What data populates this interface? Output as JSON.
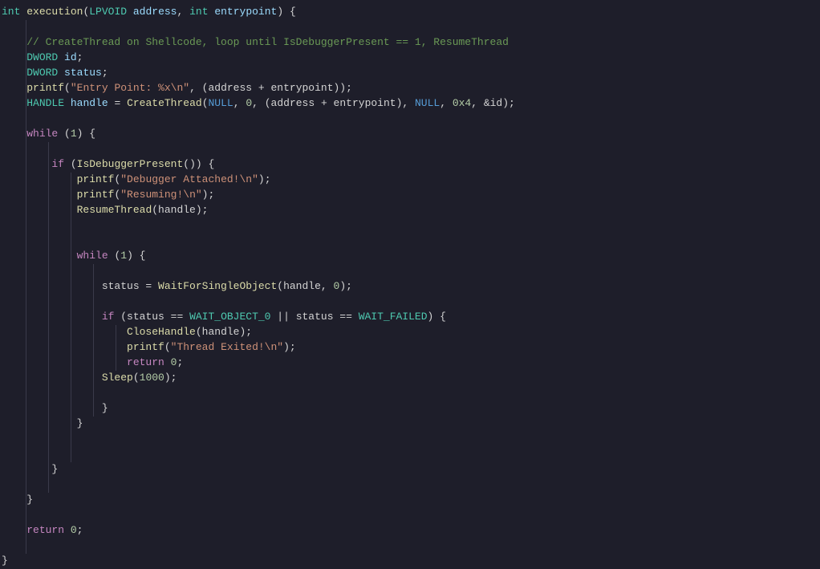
{
  "code": {
    "l0": {
      "ret_type": "int",
      "func": "execution",
      "p1_type": "LPVOID",
      "p1_name": "address",
      "comma": ",",
      "p2_type": "int",
      "p2_name": "entrypoint",
      "open": ") {"
    },
    "l2": {
      "comment": "// CreateThread on Shellcode, loop until IsDebuggerPresent == 1, ResumeThread"
    },
    "l3": {
      "type": "DWORD",
      "name": "id",
      "semi": ";"
    },
    "l4": {
      "type": "DWORD",
      "name": "status",
      "semi": ";"
    },
    "l5": {
      "func": "printf",
      "open": "(",
      "str": "\"Entry Point: %x\\n\"",
      "args": ", (address + entrypoint));"
    },
    "l6": {
      "type": "HANDLE",
      "name": "handle",
      "eq": " = ",
      "func": "CreateThread",
      "open": "(",
      "null1": "NULL",
      "c1": ", ",
      "n0": "0",
      "c2": ", (address + entrypoint), ",
      "null2": "NULL",
      "c3": ", ",
      "hex": "0x4",
      "c4": ", &id);"
    },
    "l8": {
      "kw": "while",
      "rest": " (",
      "num": "1",
      "close": ") {"
    },
    "l10": {
      "kw": "if",
      "open": " (",
      "func": "IsDebuggerPresent",
      "rest": "()) {"
    },
    "l11": {
      "func": "printf",
      "open": "(",
      "str": "\"Debugger Attached!\\n\"",
      "close": ");"
    },
    "l12": {
      "func": "printf",
      "open": "(",
      "str": "\"Resuming!\\n\"",
      "close": ");"
    },
    "l13": {
      "func": "ResumeThread",
      "args": "(handle);"
    },
    "l16": {
      "kw": "while",
      "open": " (",
      "num": "1",
      "close": ") {"
    },
    "l18": {
      "assign": "status = ",
      "func": "WaitForSingleObject",
      "args": "(handle, ",
      "num": "0",
      "close": ");"
    },
    "l20": {
      "kw": "if",
      "open": " (status == ",
      "m1": "WAIT_OBJECT_0",
      "or": " || status == ",
      "m2": "WAIT_FAILED",
      "close": ") {"
    },
    "l21": {
      "func": "CloseHandle",
      "args": "(handle);"
    },
    "l22": {
      "func": "printf",
      "open": "(",
      "str": "\"Thread Exited!\\n\"",
      "close": ");"
    },
    "l23": {
      "kw": "return",
      "sp": " ",
      "num": "0",
      "semi": ";"
    },
    "l24": {
      "func": "Sleep",
      "open": "(",
      "num": "1000",
      "close": ");"
    },
    "l26": {
      "brace": "}"
    },
    "l27": {
      "brace": "}"
    },
    "l30": {
      "brace": "}"
    },
    "l32": {
      "brace": "}"
    },
    "l34": {
      "kw": "return",
      "sp": " ",
      "num": "0",
      "semi": ";"
    },
    "l36": {
      "brace": "}"
    }
  }
}
